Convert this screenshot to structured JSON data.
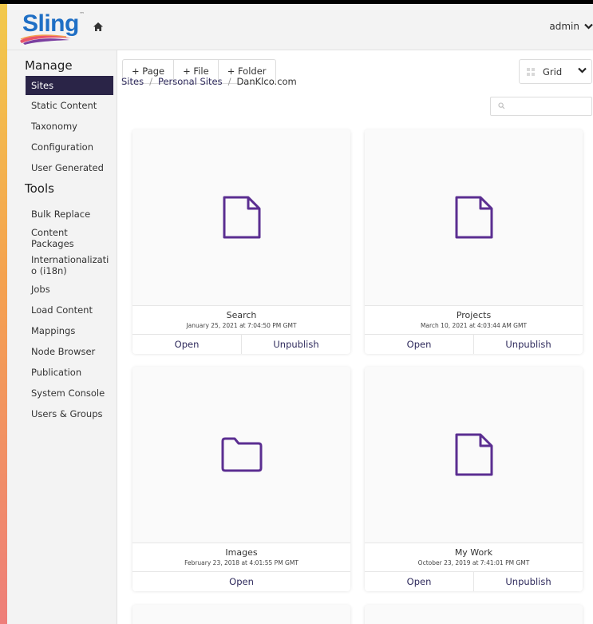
{
  "brand": {
    "name": "Sling",
    "tm": "™",
    "accent_color": "#5b2e91",
    "nav_active_color": "#2a2447"
  },
  "header": {
    "user": "admin"
  },
  "sidebar": {
    "sections": [
      {
        "title": "Manage",
        "items": [
          "Sites",
          "Static Content",
          "Taxonomy",
          "Configuration",
          "User Generated"
        ]
      },
      {
        "title": "Tools",
        "items": [
          "Bulk Replace",
          "Content Packages",
          "Internationalizatio (i18n)",
          "Jobs",
          "Load Content",
          "Mappings",
          "Node Browser",
          "Publication",
          "System Console",
          "Users & Groups"
        ]
      }
    ],
    "active_item": "Sites"
  },
  "toolbar": {
    "add_page": "+ Page",
    "add_file": "+ File",
    "add_folder": "+ Folder",
    "view_mode": "Grid"
  },
  "breadcrumb": [
    "Sites",
    "Personal Sites",
    "DanKlco.com"
  ],
  "breadcrumb_sep": "/",
  "search": {
    "placeholder": ""
  },
  "cards": [
    {
      "icon": "file-icon",
      "title": "Search",
      "date": "January 25, 2021 at 7:04:50 PM GMT",
      "actions": [
        "Open",
        "Unpublish"
      ]
    },
    {
      "icon": "file-icon",
      "title": "Projects",
      "date": "March 10, 2021 at 4:03:44 AM GMT",
      "actions": [
        "Open",
        "Unpublish"
      ]
    },
    {
      "icon": "folder-icon",
      "title": "Images",
      "date": "February 23, 2018 at 4:01:55 PM GMT",
      "actions": [
        "Open"
      ]
    },
    {
      "icon": "file-icon",
      "title": "My Work",
      "date": "October 23, 2019 at 7:41:01 PM GMT",
      "actions": [
        "Open",
        "Unpublish"
      ]
    }
  ]
}
